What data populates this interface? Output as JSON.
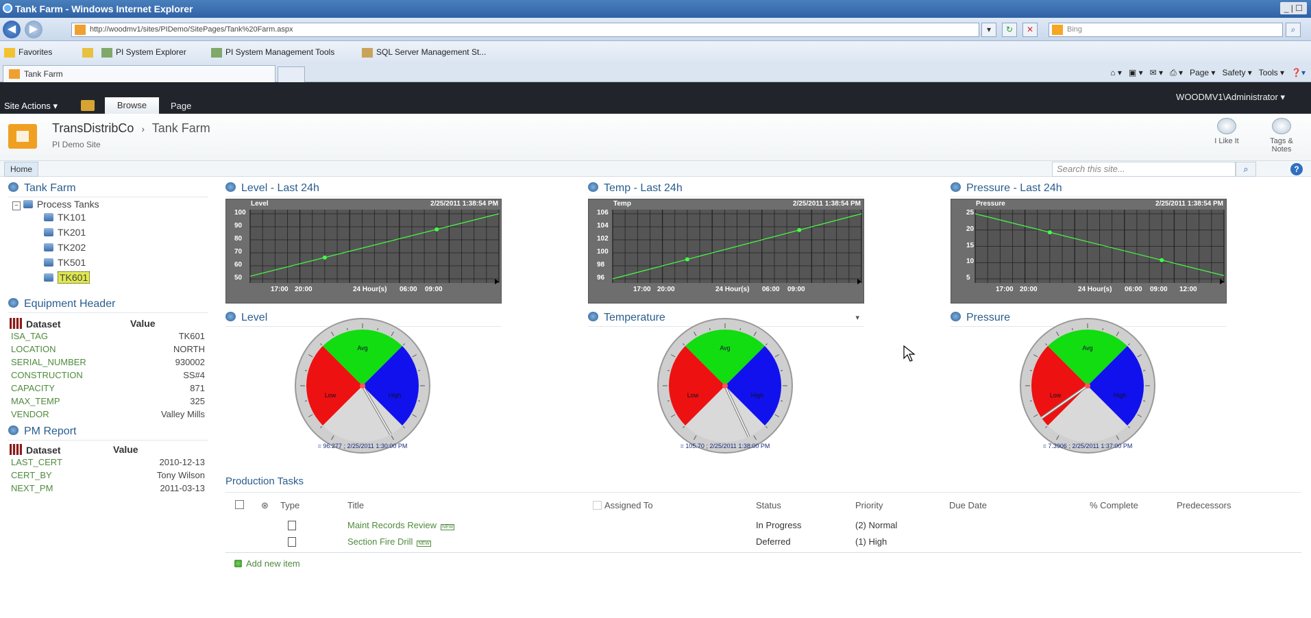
{
  "window": {
    "title": "Tank Farm - Windows Internet Explorer",
    "controls": "_ | ☐"
  },
  "browser": {
    "url": "http://woodmv1/sites/PIDemo/SitePages/Tank%20Farm.aspx",
    "search_engine": "Bing",
    "favorites_label": "Favorites",
    "favorites": [
      "PI System Explorer",
      "PI System Management Tools",
      "SQL Server Management St..."
    ],
    "tab_title": "Tank Farm",
    "command_bar": [
      "Page ▾",
      "Safety ▾",
      "Tools ▾"
    ]
  },
  "ribbon": {
    "site_actions": "Site Actions ▾",
    "tab_browse": "Browse",
    "tab_page": "Page",
    "user": "WOODMV1\\Administrator ▾"
  },
  "site": {
    "breadcrumb_root": "TransDistribCo",
    "breadcrumb_sep": "›",
    "breadcrumb_page": "Tank Farm",
    "subtitle": "PI Demo Site",
    "i_like_it": "I Like It",
    "tags_notes_1": "Tags &",
    "tags_notes_2": "Notes"
  },
  "nav": {
    "home": "Home",
    "search_placeholder": "Search this site...",
    "help": "?"
  },
  "tree": {
    "title": "Tank Farm",
    "root": "Process Tanks",
    "items": [
      "TK101",
      "TK201",
      "TK202",
      "TK501",
      "TK601"
    ],
    "selected": "TK601"
  },
  "equipment": {
    "title": "Equipment Header",
    "col_dataset": "Dataset",
    "col_value": "Value",
    "rows": [
      [
        "ISA_TAG",
        "TK601"
      ],
      [
        "LOCATION",
        "NORTH"
      ],
      [
        "SERIAL_NUMBER",
        "930002"
      ],
      [
        "CONSTRUCTION",
        "SS#4"
      ],
      [
        "CAPACITY",
        "871"
      ],
      [
        "MAX_TEMP",
        "325"
      ],
      [
        "VENDOR",
        "Valley Mills"
      ]
    ]
  },
  "pm": {
    "title": "PM Report",
    "col_dataset": "Dataset",
    "col_value": "Value",
    "rows": [
      [
        "LAST_CERT",
        "2010-12-13"
      ],
      [
        "CERT_BY",
        "Tony Wilson"
      ],
      [
        "NEXT_PM",
        "2011-03-13"
      ]
    ]
  },
  "trends": [
    {
      "title": "Level - Last 24h",
      "label": "Level",
      "timestamp": "2/25/2011 1:38:54 PM",
      "yticks": [
        "100",
        "90",
        "80",
        "70",
        "60",
        "50"
      ],
      "xticks": [
        "17:00",
        "20:00",
        "24 Hour(s)",
        "06:00",
        "09:00"
      ],
      "start": 52,
      "end": 100,
      "ymin": 50,
      "ymax": 100
    },
    {
      "title": "Temp - Last 24h",
      "label": "Temp",
      "timestamp": "2/25/2011 1:38:54 PM",
      "yticks": [
        "106",
        "104",
        "102",
        "100",
        "98",
        "96"
      ],
      "xticks": [
        "17:00",
        "20:00",
        "24 Hour(s)",
        "06:00",
        "09:00"
      ],
      "start": 96,
      "end": 106,
      "ymin": 96,
      "ymax": 106
    },
    {
      "title": "Pressure - Last 24h",
      "label": "Pressure",
      "timestamp": "2/25/2011 1:38:54 PM",
      "yticks": [
        "25",
        "20",
        "15",
        "10",
        "5"
      ],
      "xticks": [
        "17:00",
        "20:00",
        "24 Hour(s)",
        "06:00",
        "09:00",
        "12:00"
      ],
      "start": 25,
      "end": 6,
      "ymin": 5,
      "ymax": 25
    }
  ],
  "gauges": [
    {
      "title": "Level",
      "caption": "= 96.277 ; 2/25/2011 1:30:00 PM",
      "low": "Low",
      "avg": "Avg",
      "high": "High",
      "needle_deg": 150
    },
    {
      "title": "Temperature",
      "caption": "= 105.70 ; 2/25/2011 1:38:00 PM",
      "low": "Low",
      "avg": "Avg",
      "high": "High",
      "needle_deg": 155
    },
    {
      "title": "Pressure",
      "caption": "= 7.3906 ; 2/25/2011 1:37:00 PM",
      "low": "Low",
      "avg": "Avg",
      "high": "High",
      "needle_deg": 235
    }
  ],
  "temperature_menu": "▾",
  "tasks": {
    "title": "Production Tasks",
    "headers": [
      "Type",
      "Title",
      "Assigned To",
      "Status",
      "Priority",
      "Due Date",
      "% Complete",
      "Predecessors"
    ],
    "rows": [
      {
        "title": "Maint Records Review",
        "badge": "NEW",
        "status": "In Progress",
        "priority": "(2) Normal"
      },
      {
        "title": "Section Fire Drill",
        "badge": "NEW",
        "status": "Deferred",
        "priority": "(1) High"
      }
    ],
    "add_new": "Add new item"
  },
  "colors": {
    "low": "#ee1111",
    "avg": "#11dd11",
    "high": "#1111ee",
    "link": "#4f8a3d",
    "ribbon": "#21252b",
    "trend_line": "#44ff44"
  }
}
